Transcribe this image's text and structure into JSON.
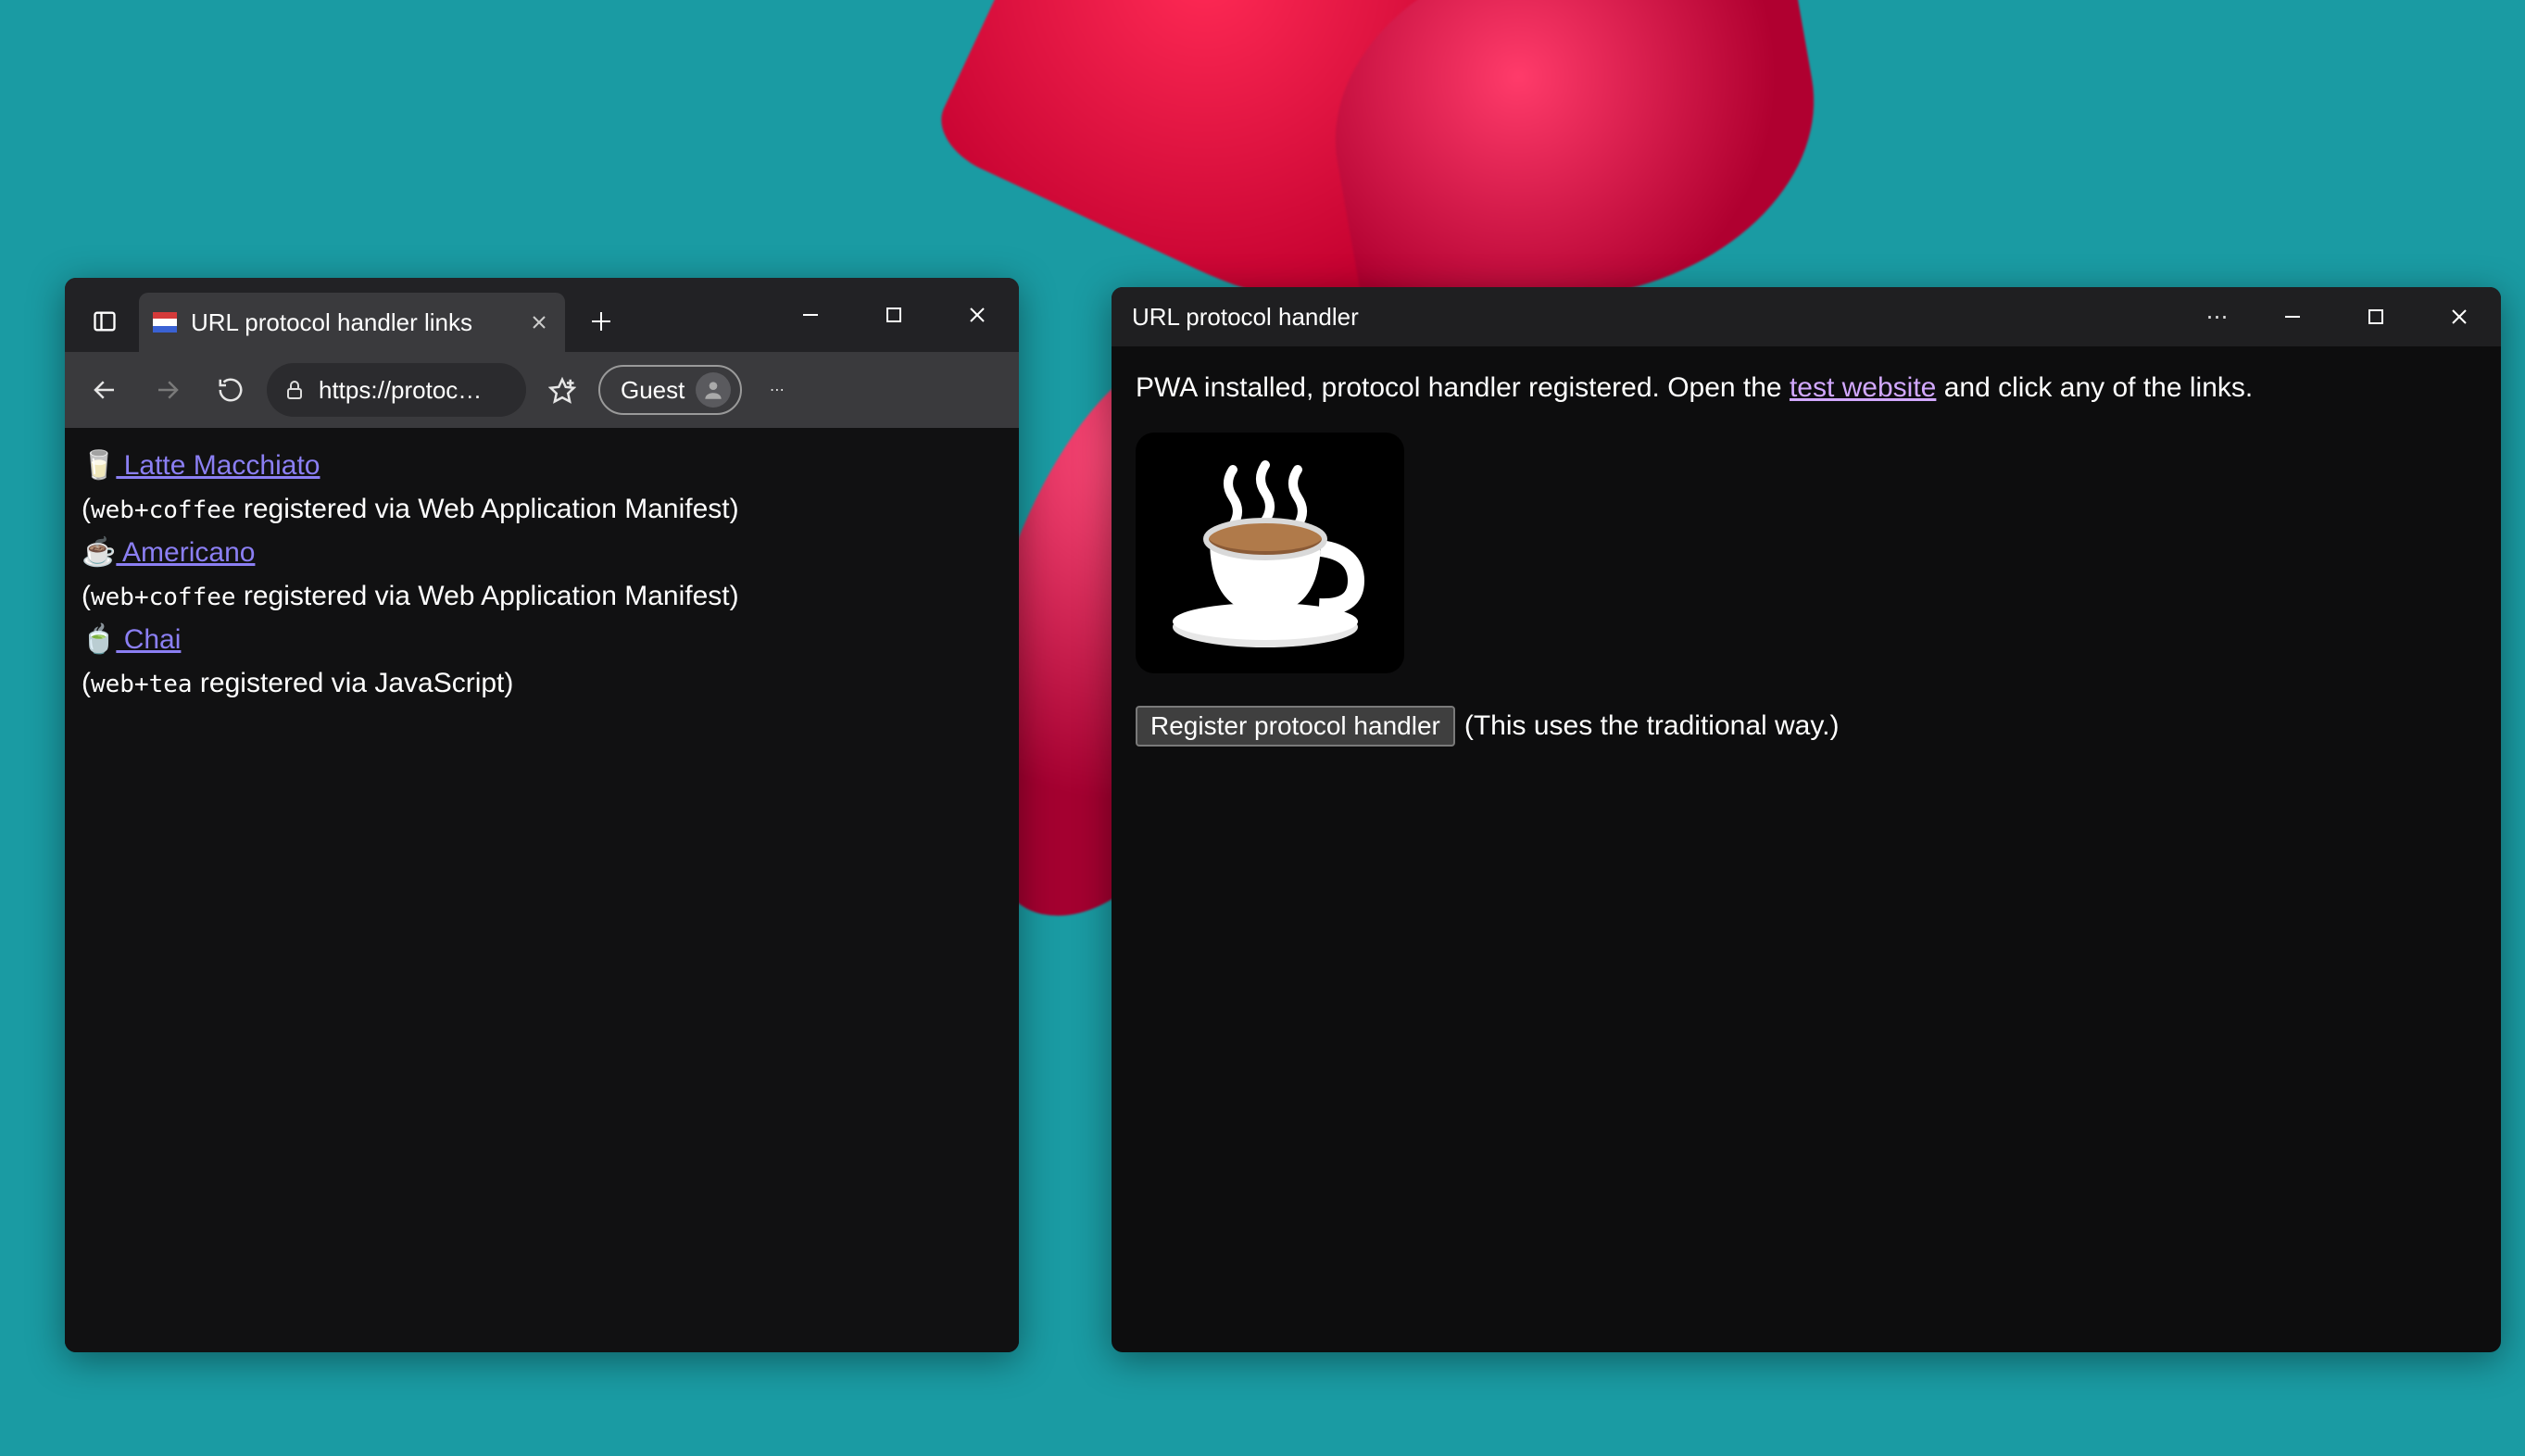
{
  "browser": {
    "tab_title": "URL protocol handler links",
    "address": "https://protoc…",
    "guest_label": "Guest",
    "content": {
      "items": [
        {
          "emoji": "🥛",
          "link_label": "  Latte Macchiato",
          "note_prefix": "(",
          "protocol": "web+coffee",
          "note_suffix": " registered via Web Application Manifest)"
        },
        {
          "emoji": "☕",
          "link_label": "  Americano",
          "note_prefix": "(",
          "protocol": "web+coffee",
          "note_suffix": " registered via Web Application Manifest)"
        },
        {
          "emoji": "🍵",
          "link_label": "  Chai",
          "note_prefix": "(",
          "protocol": "web+tea",
          "note_suffix": " registered via JavaScript)"
        }
      ]
    }
  },
  "pwa": {
    "title": "URL protocol handler",
    "body_prefix": "PWA installed, protocol handler registered. Open the ",
    "link_label": "test website",
    "body_suffix": " and click any of the links.",
    "register_button": "Register protocol handler",
    "register_note": "(This uses the traditional way.)"
  }
}
